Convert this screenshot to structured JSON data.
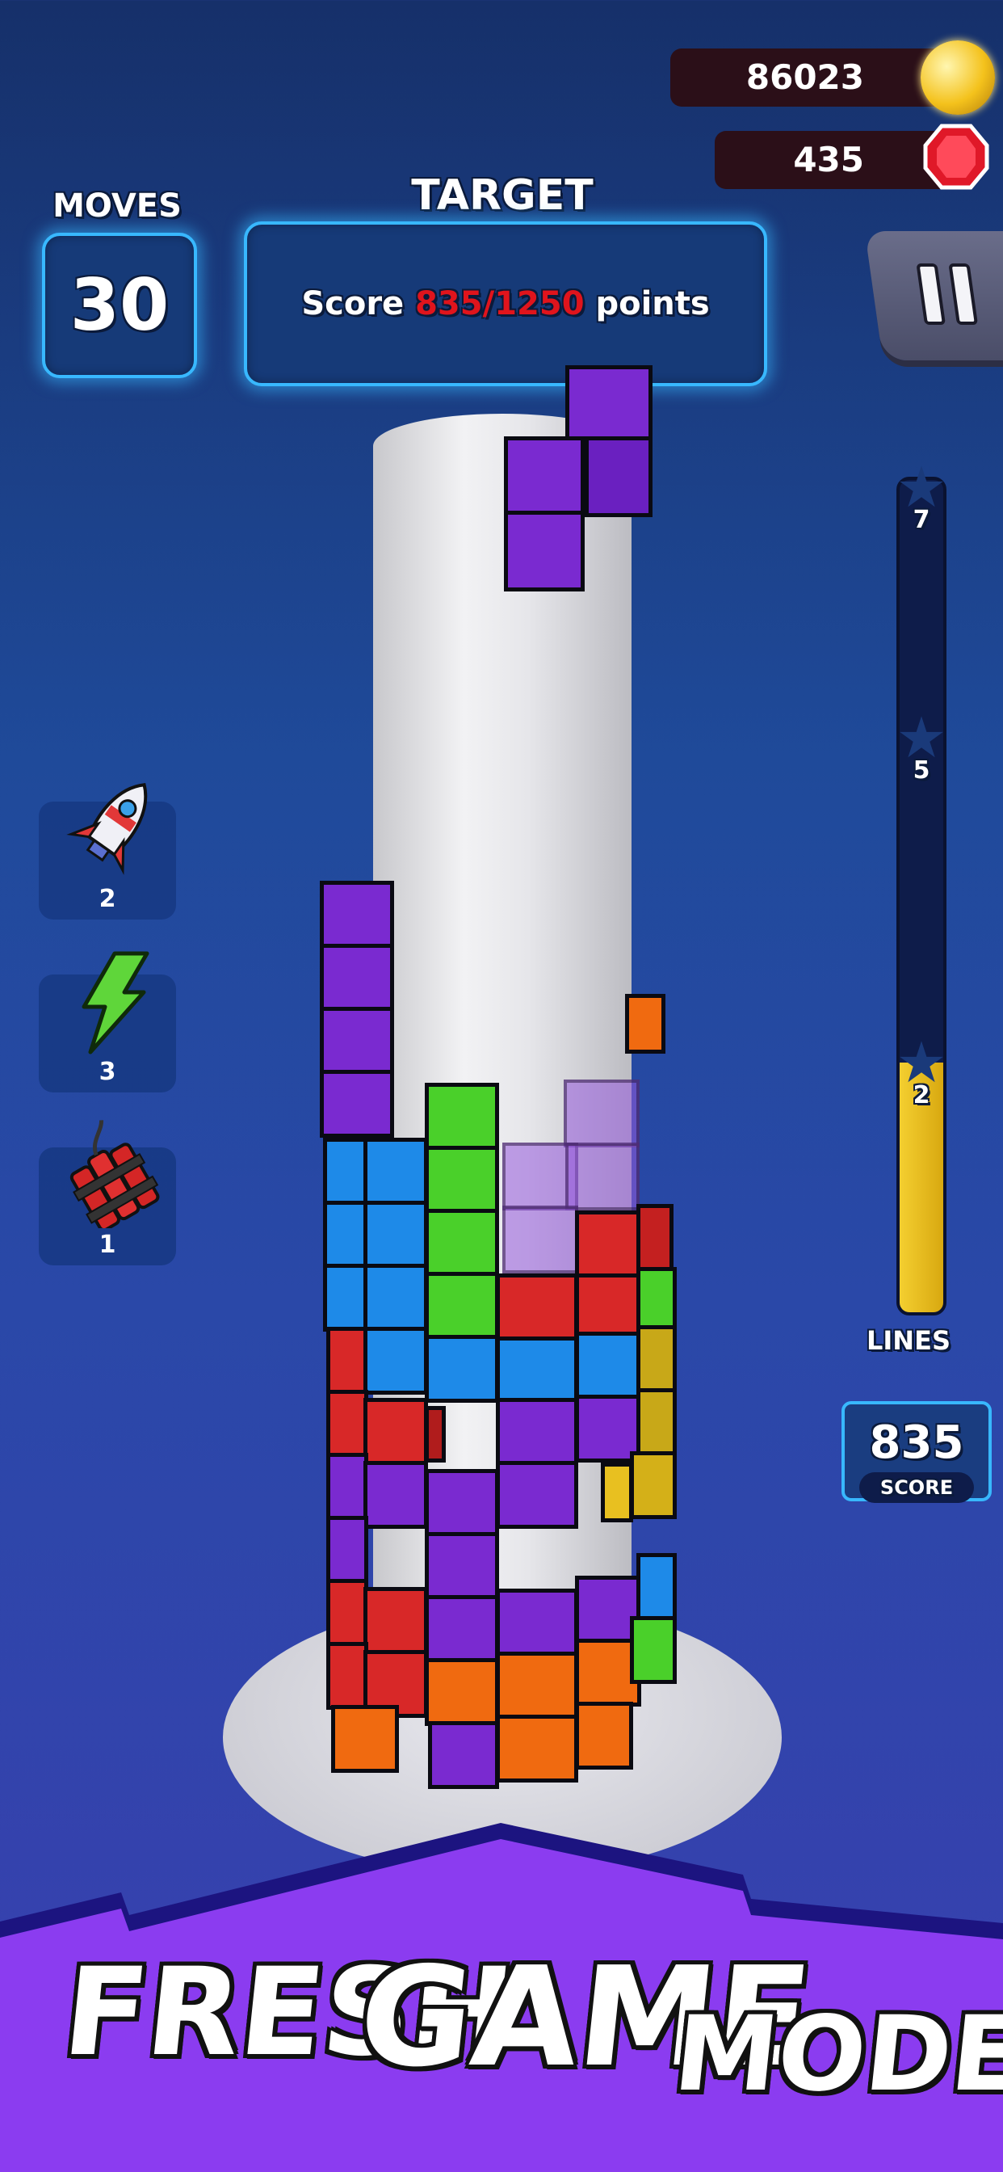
{
  "currency": {
    "coins": "86023",
    "gems": "435"
  },
  "moves": {
    "label": "MOVES",
    "value": "30"
  },
  "target": {
    "label": "TARGET",
    "prefix": "Score ",
    "current": "835/1250",
    "suffix": " points"
  },
  "powerups": [
    {
      "name": "rocket",
      "count": "2"
    },
    {
      "name": "lightning",
      "count": "3"
    },
    {
      "name": "dynamite",
      "count": "1"
    }
  ],
  "progress": {
    "milestones": [
      "7",
      "5",
      "2"
    ],
    "lines_label": "LINES",
    "fill_fraction": 0.3
  },
  "score": {
    "value": "835",
    "label": "SCORE"
  },
  "banner": {
    "word1": "FRESH",
    "word2": "GAME",
    "word3": "MODES"
  },
  "colors": {
    "accent_glow": "#38b8ff",
    "banner_purple": "#8b3cf0",
    "score_red": "#e0141c",
    "progress_yellow": "#f0c020"
  }
}
